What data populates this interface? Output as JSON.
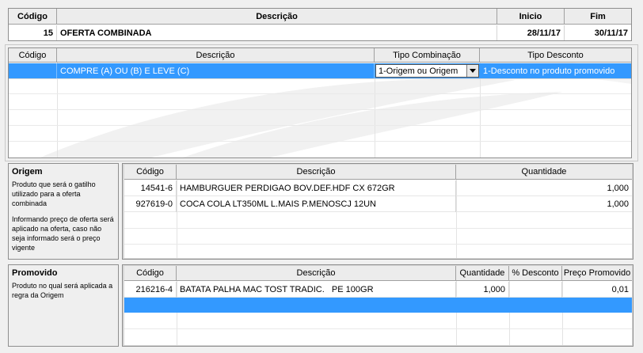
{
  "offer": {
    "col_codigo": "Código",
    "col_descricao": "Descrição",
    "col_inicio": "Inicio",
    "col_fim": "Fim",
    "codigo": "15",
    "descricao": "OFERTA COMBINADA",
    "inicio": "28/11/17",
    "fim": "30/11/17"
  },
  "combination": {
    "col_codigo": "Código",
    "col_descricao": "Descrição",
    "col_tipo_combinacao": "Tipo Combinação",
    "col_tipo_desconto": "Tipo Desconto",
    "row": {
      "codigo": "",
      "descricao": "COMPRE (A) OU (B) E LEVE (C)",
      "tipo_combinacao": "1-Origem ou Origem",
      "tipo_desconto": "1-Desconto no produto promovido"
    }
  },
  "origem": {
    "title": "Origem",
    "text1": "Produto que será o gatilho utilizado para a oferta combinada",
    "text2": "Informando preço de oferta será aplicado na oferta, caso não seja informado será o preço vigente",
    "col_codigo": "Código",
    "col_descricao": "Descrição",
    "col_quantidade": "Quantidade",
    "rows": [
      {
        "codigo": "14541-6",
        "descricao": "HAMBURGUER PERDIGAO BOV.DEF.HDF CX 672GR",
        "quantidade": "1,000"
      },
      {
        "codigo": "927619-0",
        "descricao": "COCA COLA LT350ML L.MAIS P.MENOSCJ  12UN",
        "quantidade": "1,000"
      }
    ]
  },
  "promovido": {
    "title": "Promovido",
    "text1": "Produto no qual será aplicada a regra da Origem",
    "col_codigo": "Código",
    "col_descricao": "Descrição",
    "col_quantidade": "Quantidade",
    "col_desconto": "% Desconto",
    "col_preco": "Preço Promovido",
    "rows": [
      {
        "codigo": "216216-4",
        "descricao": "BATATA PALHA MAC TOST TRADIC.   PE 100GR",
        "quantidade": "1,000",
        "desconto": "",
        "preco": "0,01"
      }
    ]
  },
  "colors": {
    "selection": "#3399ff",
    "header_bg": "#ececec",
    "panel_bg": "#f0f0f0"
  },
  "icons": {
    "combo_arrow": "chevron-down-icon"
  }
}
